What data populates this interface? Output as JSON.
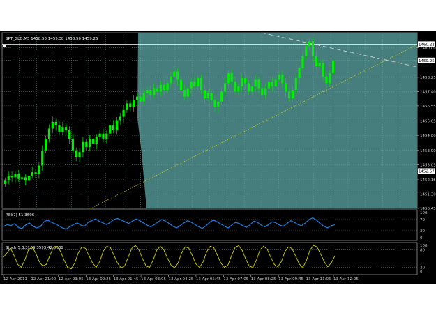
{
  "chart_data": [
    {
      "type": "candlestick",
      "title": "SPT_GLD,M5  1458.50 1459.38 1458.50 1459.25",
      "symbol": "SPT_GLD,M5",
      "ohlc_header": [
        "1458.50",
        "1459.38",
        "1458.50",
        "1459.25"
      ],
      "x_tick_labels": [
        "12 Apr 2011",
        "12 Apr 21:00",
        "12 Apr 23:05",
        "13 Apr 00:25",
        "13 Apr 01:45",
        "13 Apr 03:05",
        "13 Apr 04:25",
        "13 Apr 05:45",
        "13 Apr 07:05",
        "13 Apr 08:25",
        "13 Apr 09:45",
        "13 Apr 11:05",
        "13 Apr 12:25"
      ],
      "y_tick_labels": [
        "1460.22",
        "1460.00",
        "1459.25",
        "1458.25",
        "1457.40",
        "1456.55",
        "1455.65",
        "1454.80",
        "1453.90",
        "1453.05",
        "1452.67",
        "1452.15",
        "1451.30",
        "1450.45"
      ],
      "ylim": [
        1450.45,
        1460.9
      ],
      "price_tag_current": "1459.25",
      "horizontal_levels": [
        {
          "value": 1460.22,
          "label": "1460.22"
        },
        {
          "value": 1452.67,
          "label": "1452.67"
        }
      ],
      "close_path": [
        1452.1,
        1452.4,
        1452.3,
        1452.5,
        1452.2,
        1452.3,
        1452.1,
        1452.4,
        1452.6,
        1452.5,
        1453.0,
        1453.9,
        1454.6,
        1455.2,
        1455.6,
        1455.4,
        1455.0,
        1455.3,
        1455.1,
        1454.6,
        1453.9,
        1453.5,
        1453.8,
        1454.4,
        1454.1,
        1454.6,
        1454.3,
        1454.7,
        1454.9,
        1454.6,
        1454.9,
        1455.4,
        1455.1,
        1455.7,
        1455.9,
        1456.3,
        1456.7,
        1456.5,
        1456.9,
        1457.1,
        1456.8,
        1457.3,
        1457.5,
        1457.2,
        1457.6,
        1457.4,
        1457.8,
        1457.5,
        1457.9,
        1458.3,
        1458.6,
        1458.1,
        1457.5,
        1457.1,
        1457.6,
        1458.0,
        1457.7,
        1458.2,
        1457.5,
        1457.0,
        1457.3,
        1456.9,
        1456.5,
        1456.8,
        1457.4,
        1457.9,
        1458.5,
        1458.0,
        1457.4,
        1457.7,
        1458.2,
        1457.9,
        1457.4,
        1457.7,
        1458.1,
        1457.6,
        1457.2,
        1457.6,
        1458.0,
        1457.7,
        1458.1,
        1458.4,
        1457.9,
        1457.4,
        1457.0,
        1457.5,
        1458.2,
        1458.8,
        1459.5,
        1460.1,
        1460.4,
        1459.5,
        1458.9,
        1459.1,
        1458.3,
        1457.9,
        1458.5,
        1459.25
      ]
    },
    {
      "type": "line",
      "title": "RSI(7) 51.3606",
      "y_tick_labels": [
        "100",
        "70",
        "30",
        "0"
      ],
      "ylim": [
        0,
        100
      ],
      "series": [
        {
          "name": "RSI(7) 51.3606",
          "color": "#1e7fe0",
          "values": [
            45,
            52,
            48,
            55,
            42,
            38,
            50,
            58,
            46,
            40,
            44,
            62,
            68,
            60,
            55,
            48,
            40,
            36,
            44,
            52,
            58,
            50,
            46,
            60,
            66,
            72,
            64,
            58,
            52,
            60,
            70,
            74,
            68,
            62,
            56,
            64,
            72,
            66,
            58,
            50,
            44,
            52,
            62,
            70,
            64,
            56,
            46,
            40,
            48,
            58,
            66,
            60,
            52,
            44,
            38,
            48,
            60,
            68,
            62,
            54,
            46,
            40,
            50,
            60,
            56,
            48,
            42,
            52,
            64,
            60,
            50,
            44,
            52,
            62,
            58,
            50,
            46,
            56,
            66,
            60,
            52,
            48,
            58,
            70,
            76,
            68,
            56,
            46,
            40,
            48,
            51
          ]
        }
      ]
    },
    {
      "type": "line",
      "title": "Stoch(5,3,3) 59.3593 42.5638",
      "y_tick_labels": [
        "100",
        "80",
        "20",
        "0"
      ],
      "ylim": [
        0,
        100
      ],
      "series": [
        {
          "name": "%K",
          "color": "#d4d400",
          "values": [
            55,
            70,
            85,
            60,
            30,
            20,
            45,
            80,
            90,
            70,
            40,
            25,
            30,
            60,
            88,
            92,
            75,
            45,
            20,
            15,
            35,
            70,
            90,
            85,
            60,
            35,
            20,
            40,
            75,
            92,
            88,
            62,
            35,
            18,
            25,
            55,
            85,
            95,
            80,
            50,
            25,
            20,
            45,
            78,
            92,
            80,
            52,
            28,
            18,
            35,
            70,
            90,
            86,
            60,
            32,
            20,
            38,
            72,
            92,
            88,
            62,
            35,
            20,
            28,
            60,
            88,
            94,
            78,
            48,
            24,
            20,
            45,
            80,
            92,
            82,
            55,
            30,
            22,
            40,
            74,
            90,
            84,
            58,
            32,
            20,
            42,
            78,
            95,
            90,
            65,
            40,
            22,
            35,
            59
          ]
        }
      ]
    }
  ]
}
